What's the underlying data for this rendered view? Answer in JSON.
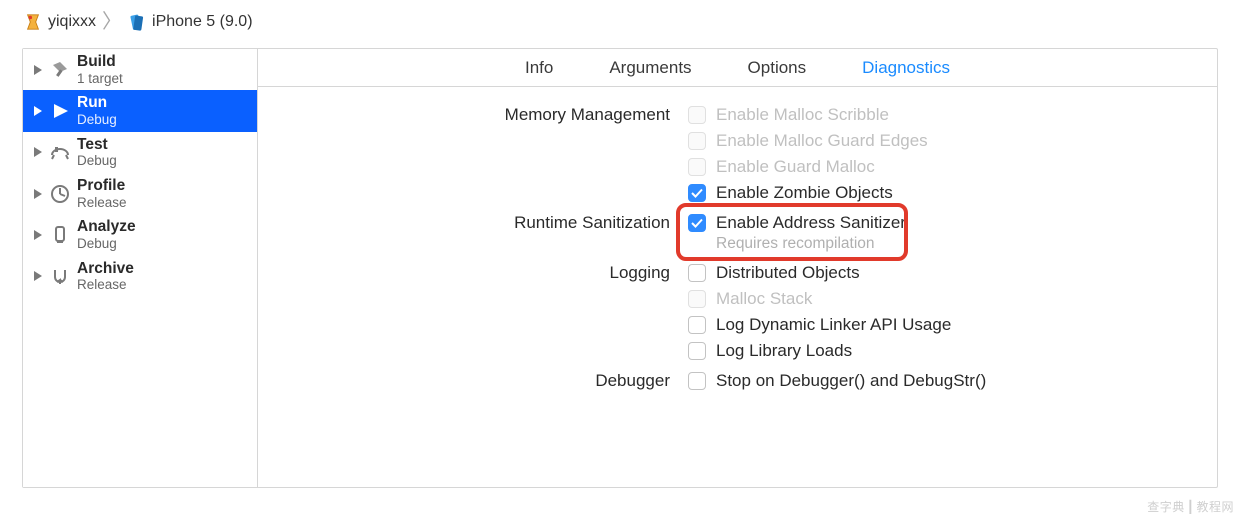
{
  "breadcrumb": {
    "scheme": "yiqixxx",
    "device": "iPhone 5 (9.0)"
  },
  "sidebar": {
    "items": [
      {
        "title": "Build",
        "subtitle": "1 target"
      },
      {
        "title": "Run",
        "subtitle": "Debug"
      },
      {
        "title": "Test",
        "subtitle": "Debug"
      },
      {
        "title": "Profile",
        "subtitle": "Release"
      },
      {
        "title": "Analyze",
        "subtitle": "Debug"
      },
      {
        "title": "Archive",
        "subtitle": "Release"
      }
    ],
    "selected_index": 1
  },
  "tabs": [
    "Info",
    "Arguments",
    "Options",
    "Diagnostics"
  ],
  "active_tab_index": 3,
  "sections": {
    "memory_management": {
      "label": "Memory Management",
      "options": [
        {
          "label": "Enable Malloc Scribble",
          "checked": false,
          "enabled": false
        },
        {
          "label": "Enable Malloc Guard Edges",
          "checked": false,
          "enabled": false
        },
        {
          "label": "Enable Guard Malloc",
          "checked": false,
          "enabled": false
        },
        {
          "label": "Enable Zombie Objects",
          "checked": true,
          "enabled": true
        }
      ]
    },
    "runtime_sanitization": {
      "label": "Runtime Sanitization",
      "options": [
        {
          "label": "Enable Address Sanitizer",
          "sublabel": "Requires recompilation",
          "checked": true,
          "enabled": true
        }
      ]
    },
    "logging": {
      "label": "Logging",
      "options": [
        {
          "label": "Distributed Objects",
          "checked": false,
          "enabled": true
        },
        {
          "label": "Malloc Stack",
          "checked": false,
          "enabled": false
        },
        {
          "label": "Log Dynamic Linker API Usage",
          "checked": false,
          "enabled": true
        },
        {
          "label": "Log Library Loads",
          "checked": false,
          "enabled": true
        }
      ]
    },
    "debugger": {
      "label": "Debugger",
      "options": [
        {
          "label": "Stop on Debugger() and DebugStr()",
          "checked": false,
          "enabled": true
        }
      ]
    }
  },
  "watermark": {
    "left": "查字典",
    "right": "教程网"
  }
}
